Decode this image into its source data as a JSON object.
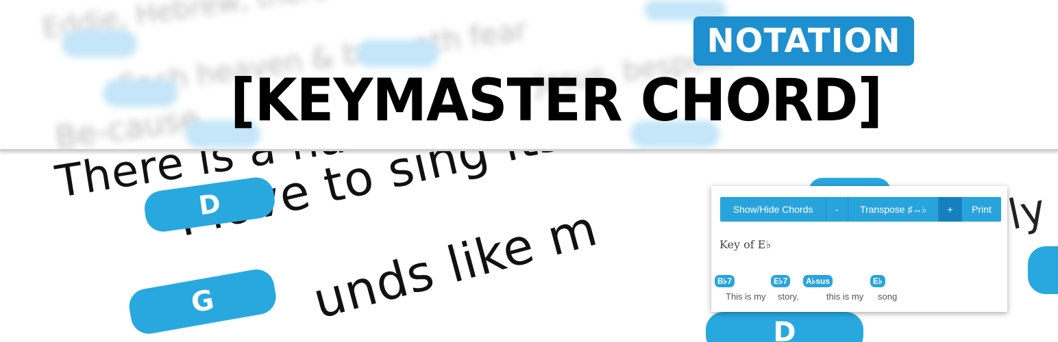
{
  "title": {
    "badge": "NOTATION",
    "main": "[KEYMASTER CHORD]"
  },
  "background": {
    "lyrics": [
      "There is a name",
      "I love to sing its wo - rth.",
      "unds like m"
    ],
    "chords": [
      "D",
      "G",
      "D"
    ]
  },
  "widget": {
    "buttons": [
      {
        "label": "Show/Hide Chords"
      },
      {
        "label": "-"
      },
      {
        "label": "Transpose ♯↔♭"
      },
      {
        "label": "+"
      },
      {
        "label": "Print"
      }
    ],
    "key_label": "Key of E♭",
    "chords": [
      "B♭7",
      "E♭7",
      "A♭sus",
      "E♭"
    ],
    "lyric_words": [
      "This is my",
      "story,",
      "this is my",
      "song"
    ]
  },
  "colors": {
    "accent": "#29a3dc",
    "badge": "#1e8fcf",
    "active_button": "#1680be"
  }
}
